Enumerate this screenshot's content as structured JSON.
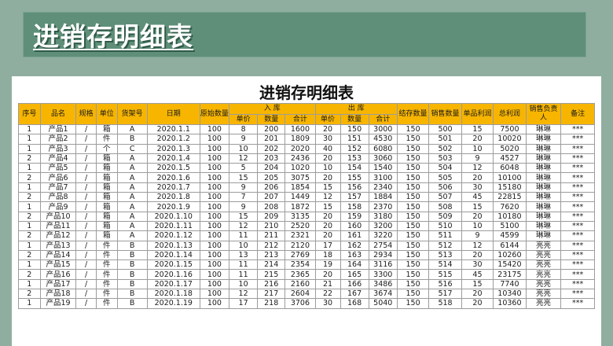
{
  "banner_title": "进销存明细表",
  "sheet_title": "进销存明细表",
  "headers": {
    "seq": "序号",
    "name": "品名",
    "spec": "规格",
    "unit": "单位",
    "cargo_no": "货架号",
    "date": "日期",
    "original": "原始数量",
    "in_group": "入 库",
    "out_group": "出 库",
    "stock": "结存数量",
    "sales": "销售数量",
    "unit_profit": "单品利润",
    "total_profit": "总利润",
    "person": "销售负责人",
    "remark": "备注",
    "sub_price": "单价",
    "sub_qty": "数量",
    "sub_total": "合计"
  },
  "rows": [
    {
      "seq": "1",
      "name": "产品1",
      "spec": "/",
      "unit": "箱",
      "cargo": "A",
      "date": "2020.1.1",
      "orig": "100",
      "in_price": "8",
      "in_qty": "200",
      "in_total": "1600",
      "out_price": "20",
      "out_qty": "150",
      "out_total": "3000",
      "stock": "150",
      "sales": "500",
      "unit_profit": "15",
      "total_profit": "7500",
      "person": "琳琳",
      "remark": "***"
    },
    {
      "seq": "1",
      "name": "产品2",
      "spec": "/",
      "unit": "件",
      "cargo": "B",
      "date": "2020.1.2",
      "orig": "100",
      "in_price": "9",
      "in_qty": "201",
      "in_total": "1809",
      "out_price": "30",
      "out_qty": "151",
      "out_total": "4530",
      "stock": "150",
      "sales": "501",
      "unit_profit": "20",
      "total_profit": "10020",
      "person": "琳琳",
      "remark": "***"
    },
    {
      "seq": "1",
      "name": "产品3",
      "spec": "/",
      "unit": "个",
      "cargo": "C",
      "date": "2020.1.3",
      "orig": "100",
      "in_price": "10",
      "in_qty": "202",
      "in_total": "2020",
      "out_price": "40",
      "out_qty": "152",
      "out_total": "6080",
      "stock": "150",
      "sales": "502",
      "unit_profit": "10",
      "total_profit": "5020",
      "person": "琳琳",
      "remark": "***"
    },
    {
      "seq": "2",
      "name": "产品4",
      "spec": "/",
      "unit": "箱",
      "cargo": "A",
      "date": "2020.1.4",
      "orig": "100",
      "in_price": "12",
      "in_qty": "203",
      "in_total": "2436",
      "out_price": "20",
      "out_qty": "153",
      "out_total": "3060",
      "stock": "150",
      "sales": "503",
      "unit_profit": "9",
      "total_profit": "4527",
      "person": "琳琳",
      "remark": "***"
    },
    {
      "seq": "1",
      "name": "产品5",
      "spec": "/",
      "unit": "箱",
      "cargo": "A",
      "date": "2020.1.5",
      "orig": "100",
      "in_price": "5",
      "in_qty": "204",
      "in_total": "1020",
      "out_price": "10",
      "out_qty": "154",
      "out_total": "1540",
      "stock": "150",
      "sales": "504",
      "unit_profit": "12",
      "total_profit": "6048",
      "person": "琳琳",
      "remark": "***"
    },
    {
      "seq": "2",
      "name": "产品6",
      "spec": "/",
      "unit": "箱",
      "cargo": "A",
      "date": "2020.1.6",
      "orig": "100",
      "in_price": "15",
      "in_qty": "205",
      "in_total": "3075",
      "out_price": "20",
      "out_qty": "155",
      "out_total": "3100",
      "stock": "150",
      "sales": "505",
      "unit_profit": "20",
      "total_profit": "10100",
      "person": "琳琳",
      "remark": "***"
    },
    {
      "seq": "1",
      "name": "产品7",
      "spec": "/",
      "unit": "箱",
      "cargo": "A",
      "date": "2020.1.7",
      "orig": "100",
      "in_price": "9",
      "in_qty": "206",
      "in_total": "1854",
      "out_price": "15",
      "out_qty": "156",
      "out_total": "2340",
      "stock": "150",
      "sales": "506",
      "unit_profit": "30",
      "total_profit": "15180",
      "person": "琳琳",
      "remark": "***"
    },
    {
      "seq": "2",
      "name": "产品8",
      "spec": "/",
      "unit": "箱",
      "cargo": "A",
      "date": "2020.1.8",
      "orig": "100",
      "in_price": "7",
      "in_qty": "207",
      "in_total": "1449",
      "out_price": "12",
      "out_qty": "157",
      "out_total": "1884",
      "stock": "150",
      "sales": "507",
      "unit_profit": "45",
      "total_profit": "22815",
      "person": "琳琳",
      "remark": "***"
    },
    {
      "seq": "1",
      "name": "产品9",
      "spec": "/",
      "unit": "箱",
      "cargo": "A",
      "date": "2020.1.9",
      "orig": "100",
      "in_price": "9",
      "in_qty": "208",
      "in_total": "1872",
      "out_price": "15",
      "out_qty": "158",
      "out_total": "2370",
      "stock": "150",
      "sales": "508",
      "unit_profit": "15",
      "total_profit": "7620",
      "person": "琳琳",
      "remark": "***"
    },
    {
      "seq": "2",
      "name": "产品10",
      "spec": "/",
      "unit": "箱",
      "cargo": "A",
      "date": "2020.1.10",
      "orig": "100",
      "in_price": "15",
      "in_qty": "209",
      "in_total": "3135",
      "out_price": "20",
      "out_qty": "159",
      "out_total": "3180",
      "stock": "150",
      "sales": "509",
      "unit_profit": "20",
      "total_profit": "10180",
      "person": "琳琳",
      "remark": "***"
    },
    {
      "seq": "1",
      "name": "产品11",
      "spec": "/",
      "unit": "箱",
      "cargo": "A",
      "date": "2020.1.11",
      "orig": "100",
      "in_price": "12",
      "in_qty": "210",
      "in_total": "2520",
      "out_price": "20",
      "out_qty": "160",
      "out_total": "3200",
      "stock": "150",
      "sales": "510",
      "unit_profit": "10",
      "total_profit": "5100",
      "person": "琳琳",
      "remark": "***"
    },
    {
      "seq": "2",
      "name": "产品12",
      "spec": "/",
      "unit": "箱",
      "cargo": "A",
      "date": "2020.1.12",
      "orig": "100",
      "in_price": "11",
      "in_qty": "211",
      "in_total": "2321",
      "out_price": "20",
      "out_qty": "161",
      "out_total": "3220",
      "stock": "150",
      "sales": "511",
      "unit_profit": "9",
      "total_profit": "4599",
      "person": "琳琳",
      "remark": "***"
    },
    {
      "seq": "1",
      "name": "产品13",
      "spec": "/",
      "unit": "件",
      "cargo": "B",
      "date": "2020.1.13",
      "orig": "100",
      "in_price": "10",
      "in_qty": "212",
      "in_total": "2120",
      "out_price": "17",
      "out_qty": "162",
      "out_total": "2754",
      "stock": "150",
      "sales": "512",
      "unit_profit": "12",
      "total_profit": "6144",
      "person": "亮亮",
      "remark": "***"
    },
    {
      "seq": "2",
      "name": "产品14",
      "spec": "/",
      "unit": "件",
      "cargo": "B",
      "date": "2020.1.14",
      "orig": "100",
      "in_price": "13",
      "in_qty": "213",
      "in_total": "2769",
      "out_price": "18",
      "out_qty": "163",
      "out_total": "2934",
      "stock": "150",
      "sales": "513",
      "unit_profit": "20",
      "total_profit": "10260",
      "person": "亮亮",
      "remark": "***"
    },
    {
      "seq": "1",
      "name": "产品15",
      "spec": "/",
      "unit": "件",
      "cargo": "B",
      "date": "2020.1.15",
      "orig": "100",
      "in_price": "11",
      "in_qty": "214",
      "in_total": "2354",
      "out_price": "19",
      "out_qty": "164",
      "out_total": "3116",
      "stock": "150",
      "sales": "514",
      "unit_profit": "30",
      "total_profit": "15420",
      "person": "亮亮",
      "remark": "***"
    },
    {
      "seq": "2",
      "name": "产品16",
      "spec": "/",
      "unit": "件",
      "cargo": "B",
      "date": "2020.1.16",
      "orig": "100",
      "in_price": "11",
      "in_qty": "215",
      "in_total": "2365",
      "out_price": "20",
      "out_qty": "165",
      "out_total": "3300",
      "stock": "150",
      "sales": "515",
      "unit_profit": "45",
      "total_profit": "23175",
      "person": "亮亮",
      "remark": "***"
    },
    {
      "seq": "1",
      "name": "产品17",
      "spec": "/",
      "unit": "件",
      "cargo": "B",
      "date": "2020.1.17",
      "orig": "100",
      "in_price": "10",
      "in_qty": "216",
      "in_total": "2160",
      "out_price": "21",
      "out_qty": "166",
      "out_total": "3486",
      "stock": "150",
      "sales": "516",
      "unit_profit": "15",
      "total_profit": "7740",
      "person": "亮亮",
      "remark": "***"
    },
    {
      "seq": "2",
      "name": "产品18",
      "spec": "/",
      "unit": "件",
      "cargo": "B",
      "date": "2020.1.18",
      "orig": "100",
      "in_price": "12",
      "in_qty": "217",
      "in_total": "2604",
      "out_price": "22",
      "out_qty": "167",
      "out_total": "3674",
      "stock": "150",
      "sales": "517",
      "unit_profit": "20",
      "total_profit": "10340",
      "person": "亮亮",
      "remark": "***"
    },
    {
      "seq": "1",
      "name": "产品19",
      "spec": "/",
      "unit": "件",
      "cargo": "B",
      "date": "2020.1.19",
      "orig": "100",
      "in_price": "17",
      "in_qty": "218",
      "in_total": "3706",
      "out_price": "30",
      "out_qty": "168",
      "out_total": "5040",
      "stock": "150",
      "sales": "518",
      "unit_profit": "20",
      "total_profit": "10360",
      "person": "亮亮",
      "remark": "***"
    }
  ]
}
